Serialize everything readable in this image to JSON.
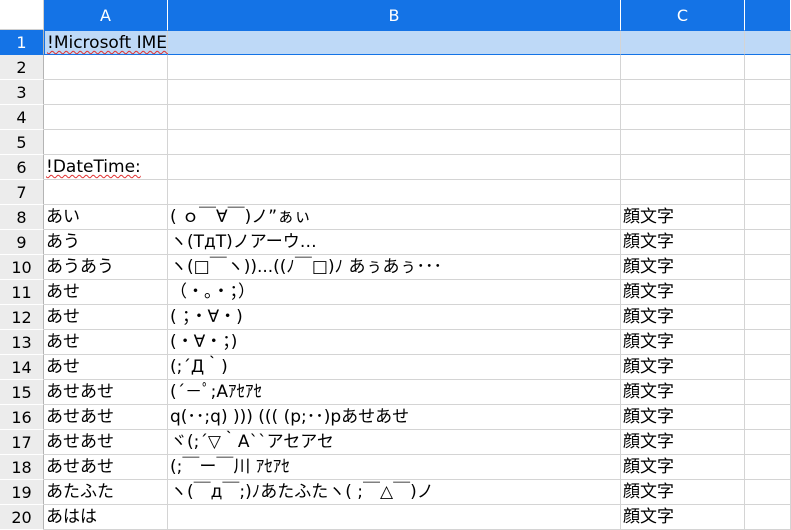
{
  "columns": [
    "A",
    "B",
    "C"
  ],
  "rows": [
    {
      "num": "1",
      "a": "!Microsoft IME Dictionary Tool",
      "b": "",
      "c": "",
      "selected": true
    },
    {
      "num": "2",
      "a": "",
      "b": "",
      "c": ""
    },
    {
      "num": "3",
      "a": "",
      "b": "",
      "c": ""
    },
    {
      "num": "4",
      "a": "",
      "b": "",
      "c": ""
    },
    {
      "num": "5",
      "a": "",
      "b": "",
      "c": ""
    },
    {
      "num": "6",
      "a": "!DateTime:",
      "b": "",
      "c": ""
    },
    {
      "num": "7",
      "a": "",
      "b": "",
      "c": ""
    },
    {
      "num": "8",
      "a": "あい",
      "b": "( ｏ￣∀￣)ノ”ぁぃ",
      "c": "顔文字"
    },
    {
      "num": "9",
      "a": "あう",
      "b": "ヽ(TдT)ノアーウ…",
      "c": "顔文字"
    },
    {
      "num": "10",
      "a": "あうあう",
      "b": "ヽ(□￣ヽ))...((ﾉ￣□)ﾉ あぅあぅ･･･",
      "c": "顔文字"
    },
    {
      "num": "11",
      "a": "あせ",
      "b": "（・。・；）",
      "c": "顔文字"
    },
    {
      "num": "12",
      "a": "あせ",
      "b": "( ；・∀・)",
      "c": "顔文字"
    },
    {
      "num": "13",
      "a": "あせ",
      "b": "(・∀・；)",
      "c": "顔文字"
    },
    {
      "num": "14",
      "a": "あせ",
      "b": "(;´Д｀)",
      "c": "顔文字"
    },
    {
      "num": "15",
      "a": "あせあせ",
      "b": "(´－ﾟ;Aｱｾｱｾ",
      "c": "顔文字"
    },
    {
      "num": "16",
      "a": "あせあせ",
      "b": "q(･･;q) ))) ((( (p;･･)pあせあせ",
      "c": "顔文字"
    },
    {
      "num": "17",
      "a": "あせあせ",
      "b": "ヾ(;´▽｀A``アセアセ",
      "c": "顔文字"
    },
    {
      "num": "18",
      "a": "あせあせ",
      "b": "(;￣ー￣川 ｱｾｱｾ",
      "c": "顔文字"
    },
    {
      "num": "19",
      "a": "あたふた",
      "b": "ヽ(￣д￣;)ﾉあたふたヽ( ;￣△￣)ノ",
      "c": "顔文字"
    },
    {
      "num": "20",
      "a": "あはは",
      "b": "",
      "c": "顔文字"
    }
  ]
}
